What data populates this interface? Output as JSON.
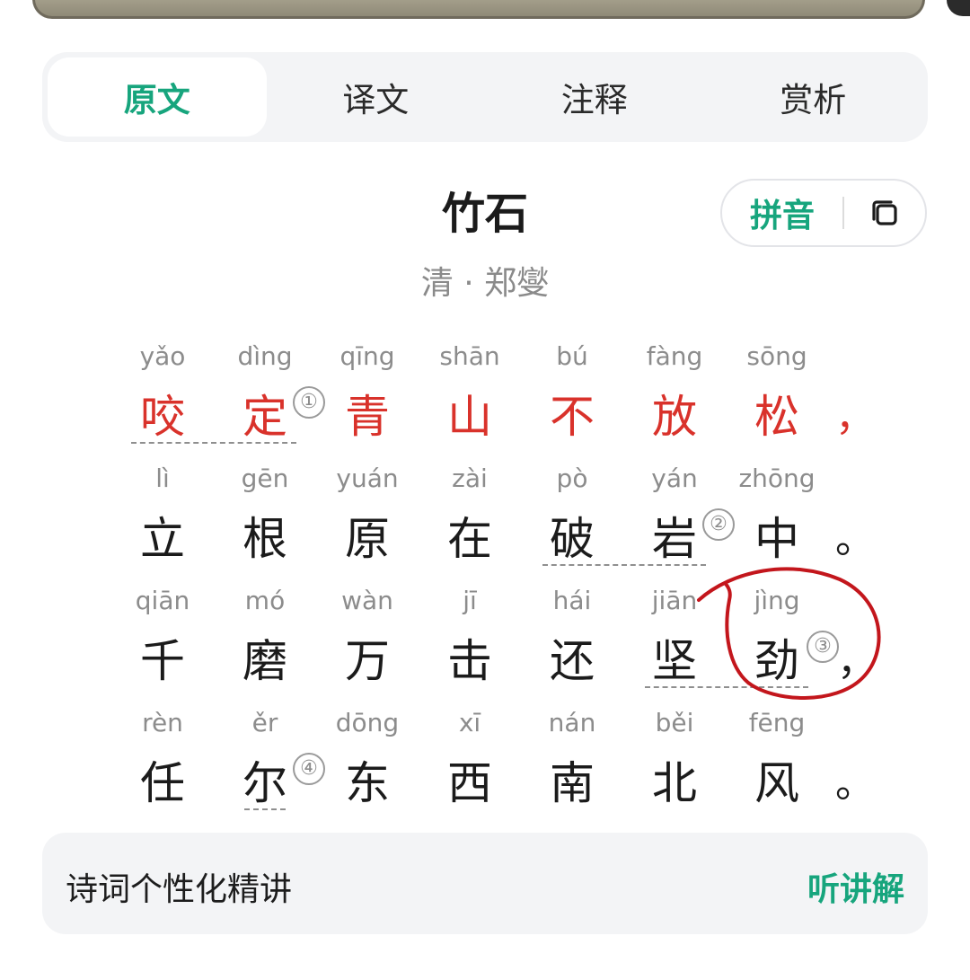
{
  "tabs": [
    {
      "label": "原文",
      "active": true
    },
    {
      "label": "译文",
      "active": false
    },
    {
      "label": "注释",
      "active": false
    },
    {
      "label": "赏析",
      "active": false
    }
  ],
  "poem": {
    "title": "竹石",
    "author": "清 · 郑燮",
    "pinyin_toggle_label": "拼音",
    "lines": [
      {
        "chars": [
          {
            "py": "yǎo",
            "hz": "咬"
          },
          {
            "py": "dìng",
            "hz": "定",
            "note": "①"
          },
          {
            "py": "qīng",
            "hz": "青"
          },
          {
            "py": "shān",
            "hz": "山"
          },
          {
            "py": "bú",
            "hz": "不"
          },
          {
            "py": "fàng",
            "hz": "放"
          },
          {
            "py": "sōng",
            "hz": "松"
          }
        ],
        "punct": "，"
      },
      {
        "chars": [
          {
            "py": "lì",
            "hz": "立"
          },
          {
            "py": "gēn",
            "hz": "根"
          },
          {
            "py": "yuán",
            "hz": "原"
          },
          {
            "py": "zài",
            "hz": "在"
          },
          {
            "py": "pò",
            "hz": "破"
          },
          {
            "py": "yán",
            "hz": "岩",
            "note": "②"
          },
          {
            "py": "zhōng",
            "hz": "中"
          }
        ],
        "punct": "。"
      },
      {
        "chars": [
          {
            "py": "qiān",
            "hz": "千"
          },
          {
            "py": "mó",
            "hz": "磨"
          },
          {
            "py": "wàn",
            "hz": "万"
          },
          {
            "py": "jī",
            "hz": "击"
          },
          {
            "py": "hái",
            "hz": "还"
          },
          {
            "py": "jiān",
            "hz": "坚"
          },
          {
            "py": "jìng",
            "hz": "劲",
            "note": "③"
          }
        ],
        "punct": "，"
      },
      {
        "chars": [
          {
            "py": "rèn",
            "hz": "任"
          },
          {
            "py": "ěr",
            "hz": "尔",
            "note": "④"
          },
          {
            "py": "dōng",
            "hz": "东"
          },
          {
            "py": "xī",
            "hz": "西"
          },
          {
            "py": "nán",
            "hz": "南"
          },
          {
            "py": "běi",
            "hz": "北"
          },
          {
            "py": "fēng",
            "hz": "风"
          }
        ],
        "punct": "。"
      }
    ]
  },
  "explain": {
    "title": "诗词个性化精讲",
    "button": "听讲解"
  },
  "colors": {
    "accent": "#17a57d",
    "highlight": "#d9322b",
    "annotation_circle": "#c3161c"
  },
  "icons": {
    "copy": "copy-icon"
  }
}
